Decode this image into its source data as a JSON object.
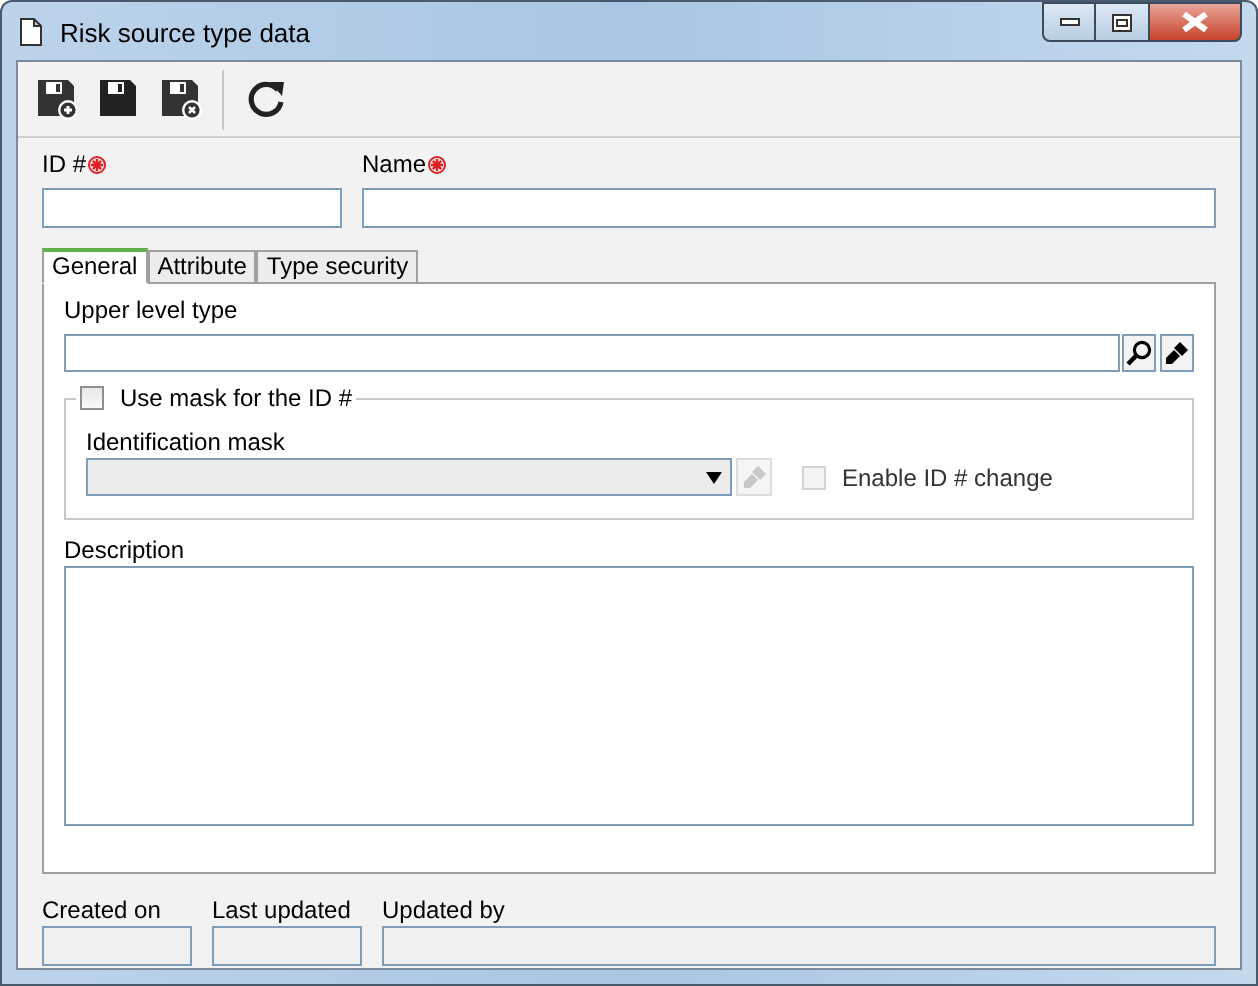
{
  "window": {
    "title": "Risk source type data"
  },
  "toolbar": [
    {
      "kind": "save-new"
    },
    {
      "kind": "save"
    },
    {
      "kind": "save-close"
    },
    {
      "kind": "separator"
    },
    {
      "kind": "refresh"
    }
  ],
  "top_fields": [
    {
      "label": "ID #",
      "required": true
    },
    {
      "label": "Name",
      "required": true
    }
  ],
  "tabs": [
    {
      "label": "General",
      "selected": true
    },
    {
      "label": "Attribute",
      "selected": false
    },
    {
      "label": "Type security",
      "selected": false
    }
  ],
  "upper_level_type": {
    "label": "Upper level type"
  },
  "mask_group": {
    "label": "Use mask for the ID #",
    "checked": false,
    "identification_mask": {
      "label": "Identification mask",
      "disabled": true
    },
    "enable_change": {
      "label": "Enable ID # change",
      "checked": false,
      "disabled": true
    }
  },
  "description": {
    "label": "Description"
  },
  "footer_fields": [
    {
      "label": "Created on",
      "disabled": true
    },
    {
      "label": "Last updated",
      "disabled": true
    },
    {
      "label": "Updated by",
      "disabled": true
    }
  ]
}
